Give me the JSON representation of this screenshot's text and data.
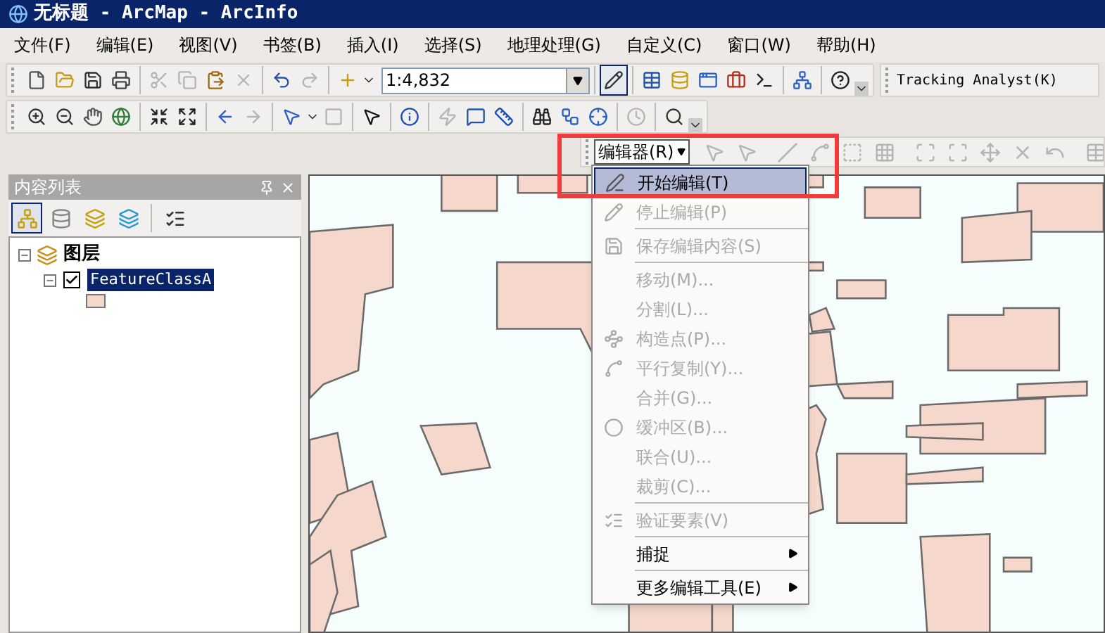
{
  "window": {
    "title": "无标题 - ArcMap - ArcInfo"
  },
  "menu_bar": [
    "文件(F)",
    "编辑(E)",
    "视图(V)",
    "书签(B)",
    "插入(I)",
    "选择(S)",
    "地理处理(G)",
    "自定义(C)",
    "窗口(W)",
    "帮助(H)"
  ],
  "standard_toolbar": {
    "buttons": [
      {
        "disabled": false
      },
      {
        "disabled": false
      },
      {
        "disabled": false
      },
      {
        "disabled": false
      },
      {
        "disabled": true
      },
      {
        "disabled": true
      },
      {
        "disabled": false
      },
      {
        "disabled": true
      },
      {
        "disabled": false
      },
      {
        "disabled": true
      },
      {
        "disabled": false
      }
    ],
    "scale": {
      "value": "1:4,832"
    },
    "tools": [
      {
        "selected": true
      },
      {
        "selected": false
      },
      {
        "selected": false
      },
      {
        "selected": false
      },
      {
        "selected": false
      },
      {
        "selected": false
      },
      {
        "selected": false
      },
      {
        "selected": false
      }
    ]
  },
  "tracking_toolbar": {
    "label": "Tracking Analyst(K)"
  },
  "tools_toolbar": {
    "buttons": [
      {
        "disabled": false
      },
      {
        "disabled": false
      },
      {
        "disabled": false
      },
      {
        "disabled": false
      },
      {
        "disabled": false
      },
      {
        "disabled": false
      },
      {
        "disabled": false
      },
      {
        "disabled": true
      },
      {
        "disabled": false
      },
      {
        "disabled": true
      },
      {
        "disabled": false
      },
      {
        "disabled": false
      },
      {
        "disabled": true
      },
      {
        "disabled": false
      },
      {
        "disabled": false
      },
      {
        "disabled": false
      },
      {
        "disabled": false
      },
      {
        "disabled": false
      },
      {
        "disabled": true
      },
      {
        "disabled": false
      }
    ]
  },
  "editor_toolbar": {
    "label": "编辑器(R)"
  },
  "toc": {
    "title": "内容列表",
    "tabs": [
      {
        "selected": true
      },
      {
        "selected": false
      },
      {
        "selected": false
      },
      {
        "selected": false
      },
      {
        "selected": false
      }
    ],
    "tree": [
      {
        "label": "图层",
        "expanded": true,
        "children": [
          {
            "label": "FeatureClassA",
            "expanded": true,
            "checked": true,
            "selected": true
          }
        ]
      }
    ]
  },
  "editor_menu": {
    "items": [
      {
        "kind": "item",
        "label": "开始编辑(T)",
        "disabled": false,
        "selected": true,
        "submenu": false
      },
      {
        "kind": "item",
        "label": "停止编辑(P)",
        "disabled": true,
        "selected": false,
        "submenu": false
      },
      {
        "kind": "separator"
      },
      {
        "kind": "item",
        "label": "保存编辑内容(S)",
        "disabled": true,
        "selected": false,
        "submenu": false
      },
      {
        "kind": "separator"
      },
      {
        "kind": "item",
        "label": "移动(M)...",
        "disabled": true,
        "selected": false,
        "submenu": false
      },
      {
        "kind": "item",
        "label": "分割(L)...",
        "disabled": true,
        "selected": false,
        "submenu": false
      },
      {
        "kind": "item",
        "label": "构造点(P)...",
        "disabled": true,
        "selected": false,
        "submenu": false
      },
      {
        "kind": "item",
        "label": "平行复制(Y)...",
        "disabled": true,
        "selected": false,
        "submenu": false
      },
      {
        "kind": "item",
        "label": "合并(G)...",
        "disabled": true,
        "selected": false,
        "submenu": false
      },
      {
        "kind": "item",
        "label": "缓冲区(B)...",
        "disabled": true,
        "selected": false,
        "submenu": false
      },
      {
        "kind": "item",
        "label": "联合(U)...",
        "disabled": true,
        "selected": false,
        "submenu": false
      },
      {
        "kind": "item",
        "label": "裁剪(C)...",
        "disabled": true,
        "selected": false,
        "submenu": false
      },
      {
        "kind": "separator"
      },
      {
        "kind": "item",
        "label": "验证要素(V)",
        "disabled": true,
        "selected": false,
        "submenu": false
      },
      {
        "kind": "separator"
      },
      {
        "kind": "item",
        "label": "捕捉",
        "disabled": false,
        "selected": false,
        "submenu": true
      },
      {
        "kind": "separator"
      },
      {
        "kind": "item",
        "label": "更多编辑工具(E)",
        "disabled": false,
        "selected": false,
        "submenu": true
      }
    ]
  }
}
